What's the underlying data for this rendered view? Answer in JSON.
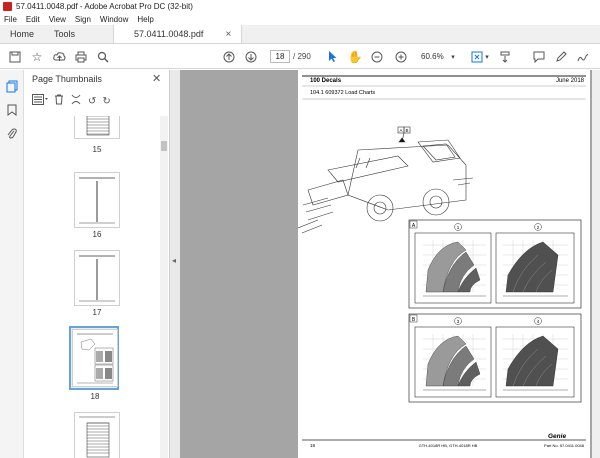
{
  "window": {
    "title": "57.0411.0048.pdf - Adobe Acrobat Pro DC (32-bit)"
  },
  "menu": [
    "File",
    "Edit",
    "View",
    "Sign",
    "Window",
    "Help"
  ],
  "tabs": {
    "home": "Home",
    "tools": "Tools",
    "document": "57.0411.0048.pdf"
  },
  "toolbar": {
    "current_page": "18",
    "total_pages": "/ 290",
    "zoom": "60.6%"
  },
  "panel": {
    "title": "Page Thumbnails",
    "thumbnails": [
      {
        "label": "15"
      },
      {
        "label": "16"
      },
      {
        "label": "17"
      },
      {
        "label": "18",
        "selected": true
      },
      {
        "label": ""
      }
    ]
  },
  "page": {
    "section": "100 Decals",
    "date": "June 2018",
    "subtitle": "104.1 609372 Load Charts",
    "callout_a": "A",
    "callout_b": "B",
    "panel_a_label": "A",
    "panel_b_label": "B",
    "chart_numbers": [
      "1",
      "2",
      "3",
      "4"
    ],
    "footer_page": "18",
    "footer_model": "GTH-4018R HB, GTH-4018R HB",
    "footer_part": "Part No. 57.0411.0048",
    "brand": "Genie"
  },
  "colors": {
    "accent": "#1473e6",
    "selected_border": "#6aa3d6",
    "doc_bg": "#a5a5a5"
  }
}
